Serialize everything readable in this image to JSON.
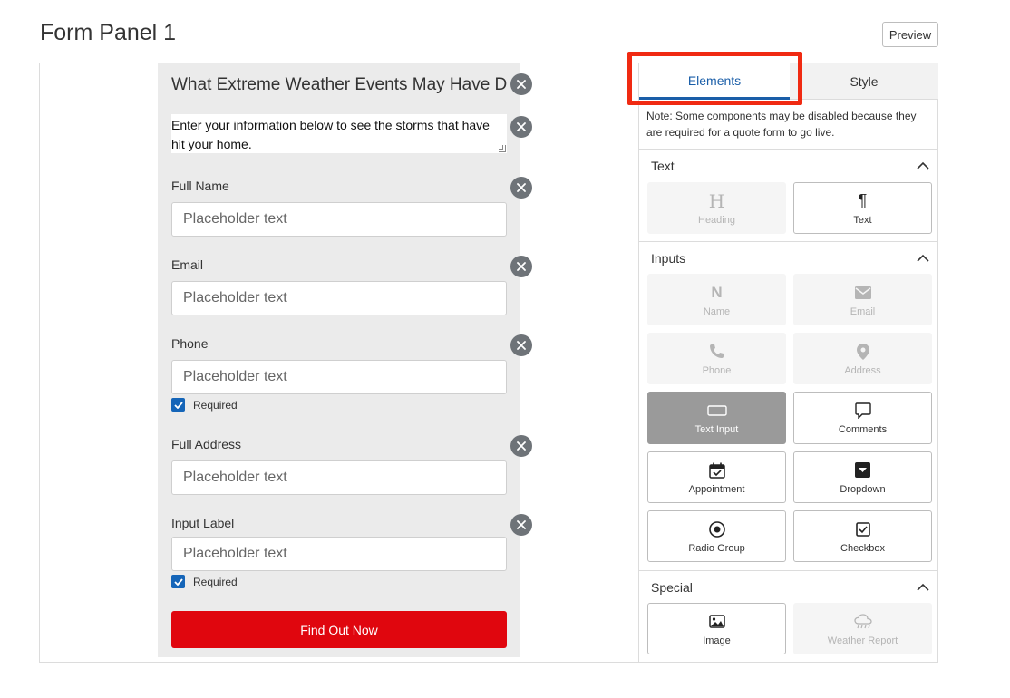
{
  "header": {
    "title": "Form Panel 1",
    "preview_label": "Preview"
  },
  "form": {
    "heading": "What Extreme Weather Events May Have Da",
    "description": "Enter your information below to see the storms that have hit your home.",
    "fields": [
      {
        "label": "Full Name",
        "placeholder": "Placeholder text"
      },
      {
        "label": "Email",
        "placeholder": "Placeholder text"
      },
      {
        "label": "Phone",
        "placeholder": "Placeholder text",
        "required_label": "Required"
      },
      {
        "label": "Full Address",
        "placeholder": "Placeholder text"
      },
      {
        "label": "Input Label",
        "placeholder": "Placeholder text",
        "required_label": "Required"
      }
    ],
    "submit_label": "Find Out Now"
  },
  "sidebar": {
    "tabs": [
      {
        "label": "Elements",
        "active": true
      },
      {
        "label": "Style",
        "active": false
      }
    ],
    "note": "Note: Some components may be disabled because they are required for a quote form to go live.",
    "sections": {
      "text": {
        "title": "Text",
        "items": [
          {
            "label": "Heading",
            "icon": "heading-icon",
            "state": "disabled"
          },
          {
            "label": "Text",
            "icon": "paragraph-icon",
            "state": "enabled"
          }
        ]
      },
      "inputs": {
        "title": "Inputs",
        "items": [
          {
            "label": "Name",
            "icon": "name-icon",
            "state": "disabled"
          },
          {
            "label": "Email",
            "icon": "envelope-icon",
            "state": "disabled"
          },
          {
            "label": "Phone",
            "icon": "phone-icon",
            "state": "disabled"
          },
          {
            "label": "Address",
            "icon": "map-pin-icon",
            "state": "disabled"
          },
          {
            "label": "Text Input",
            "icon": "text-input-icon",
            "state": "active"
          },
          {
            "label": "Comments",
            "icon": "comment-icon",
            "state": "enabled"
          },
          {
            "label": "Appointment",
            "icon": "calendar-check-icon",
            "state": "enabled"
          },
          {
            "label": "Dropdown",
            "icon": "dropdown-icon",
            "state": "enabled"
          },
          {
            "label": "Radio Group",
            "icon": "radio-icon",
            "state": "enabled"
          },
          {
            "label": "Checkbox",
            "icon": "checkbox-icon",
            "state": "enabled"
          }
        ]
      },
      "special": {
        "title": "Special",
        "items": [
          {
            "label": "Image",
            "icon": "image-icon",
            "state": "enabled"
          },
          {
            "label": "Weather Report",
            "icon": "cloud-rain-icon",
            "state": "disabled"
          }
        ]
      }
    }
  },
  "colors": {
    "accent_blue": "#1a5ea8",
    "submit_red": "#e0060e",
    "highlight_red": "#f02a12",
    "canvas_gray": "#ebebeb"
  }
}
